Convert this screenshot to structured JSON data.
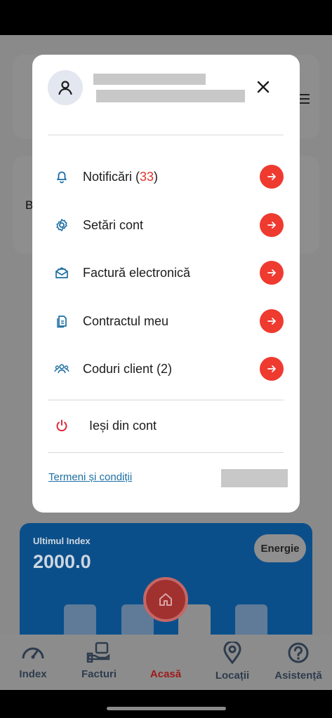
{
  "background": {
    "partial_text": "B",
    "index_card": {
      "label": "Ultimul Index",
      "value": "2000.0",
      "chip": "Energie"
    }
  },
  "bottom_nav": {
    "items": [
      {
        "label": "Index",
        "icon": "gauge-icon",
        "active": false
      },
      {
        "label": "Facturi",
        "icon": "hand-invoice-icon",
        "active": false
      },
      {
        "label": "Acasă",
        "icon": "home-icon",
        "active": true
      },
      {
        "label": "Locații",
        "icon": "location-pin-icon",
        "active": false
      },
      {
        "label": "Asistență",
        "icon": "help-circle-icon",
        "active": false
      }
    ]
  },
  "menu": {
    "items": [
      {
        "label": "Notificări (",
        "count": "33",
        "suffix": ")",
        "icon": "bell-icon"
      },
      {
        "label": "Setări cont",
        "icon": "gear-icon"
      },
      {
        "label": "Factură electronică",
        "icon": "envelope-open-icon"
      },
      {
        "label": "Contractul meu",
        "icon": "document-icon"
      },
      {
        "label": "Coduri client (2)",
        "icon": "users-icon"
      }
    ],
    "logout_label": "Ieși din cont",
    "terms_label": "Termeni și condiții"
  },
  "colors": {
    "accent": "#ef3a2f",
    "icon_blue": "#1d6fa3",
    "logout_red": "#e0283a",
    "link": "#1d6fa3"
  }
}
